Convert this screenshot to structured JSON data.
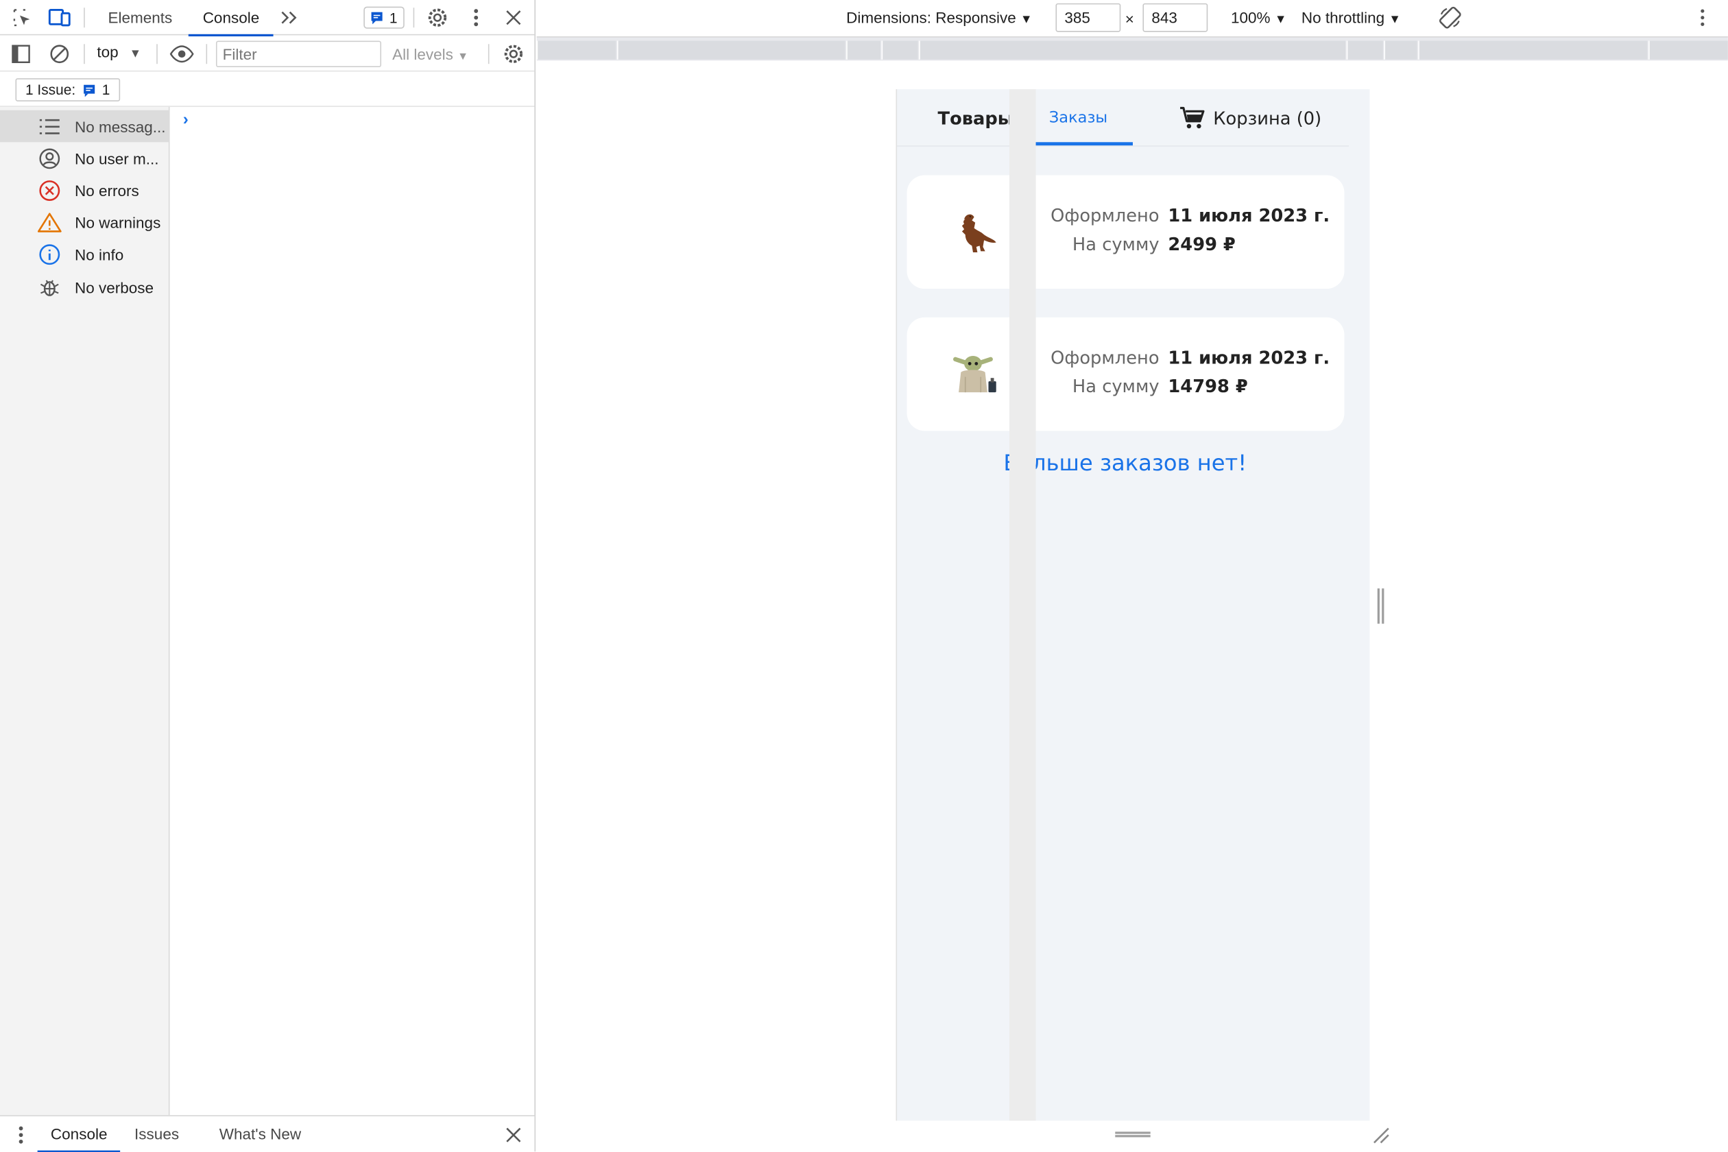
{
  "devtools": {
    "tabs": [
      "Elements",
      "Console"
    ],
    "issues_badge": "1",
    "context": "top",
    "filter_placeholder": "Filter",
    "levels": "All levels",
    "issues_button": "1 Issue:",
    "issues_count": "1",
    "sidebar": [
      {
        "label": "No messag...",
        "icon": "list-icon"
      },
      {
        "label": "No user m...",
        "icon": "user-icon"
      },
      {
        "label": "No errors",
        "icon": "error-icon"
      },
      {
        "label": "No warnings",
        "icon": "warning-icon"
      },
      {
        "label": "No info",
        "icon": "info-icon"
      },
      {
        "label": "No verbose",
        "icon": "bug-icon"
      }
    ],
    "drawer_tabs": [
      "Console",
      "Issues",
      "What's New"
    ]
  },
  "device_toolbar": {
    "dimensions_label": "Dimensions: Responsive",
    "width": "385",
    "times": "×",
    "height": "843",
    "zoom": "100%",
    "throttling": "No throttling"
  },
  "app": {
    "nav": {
      "products": "Товары",
      "orders": "Заказы",
      "cart": "Корзина (0)"
    },
    "orders": [
      {
        "ordered_label": "Оформлено",
        "date": "11 июля 2023 г.",
        "sum_label": "На сумму",
        "sum": "2499 ₽",
        "image": "dinosaur-toy"
      },
      {
        "ordered_label": "Оформлено",
        "date": "11 июля 2023 г.",
        "sum_label": "На сумму",
        "sum": "14798 ₽",
        "image": "baby-yoda-toy"
      }
    ],
    "no_more": "Больше заказов нет!"
  },
  "colors": {
    "accent": "#1a73e8",
    "page_bg": "#f1f4f8",
    "devtools_accent": "#0b57d0"
  }
}
